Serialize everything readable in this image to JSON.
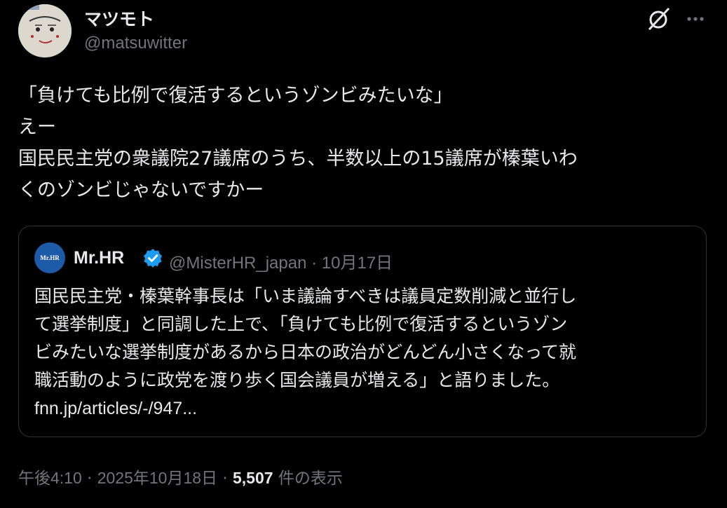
{
  "author": {
    "name": "マツモト",
    "handle": "@matsuwitter"
  },
  "icons": {
    "grok": "grok-icon",
    "more": "more-icon"
  },
  "post": {
    "lines": [
      "「負けても比例で復活するというゾンビみたいな」",
      "えー",
      "国民民主党の衆議院27議席のうち、半数以上の15議席が榛葉いわ",
      "くのゾンビじゃないですかー"
    ]
  },
  "quote": {
    "avatar_text": "Mr.HR",
    "name": "Mr.HR",
    "handle": "@MisterHR_japan",
    "separator": "·",
    "date": "10月17日",
    "lines": [
      "国民民主党・榛葉幹事長は「いま議論すべきは議員定数削減と並行し",
      "て選挙制度」と同調した上で、「負けても比例で復活するというゾン",
      "ビみたいな選挙制度があるから日本の政治がどんどん小さくなって就",
      "職活動のように政党を渡り歩く国会議員が増える」と語りました。"
    ],
    "link": "fnn.jp/articles/-/947..."
  },
  "footer": {
    "time": "午後4:10",
    "sep1": "·",
    "date": "2025年10月18日",
    "sep2": "·",
    "views": "5,507",
    "views_label": "件の表示"
  },
  "colors": {
    "background": "#000000",
    "text": "#e7e9ea",
    "muted": "#71767b",
    "border": "#2f3336",
    "verified": "#1d9bf0"
  }
}
